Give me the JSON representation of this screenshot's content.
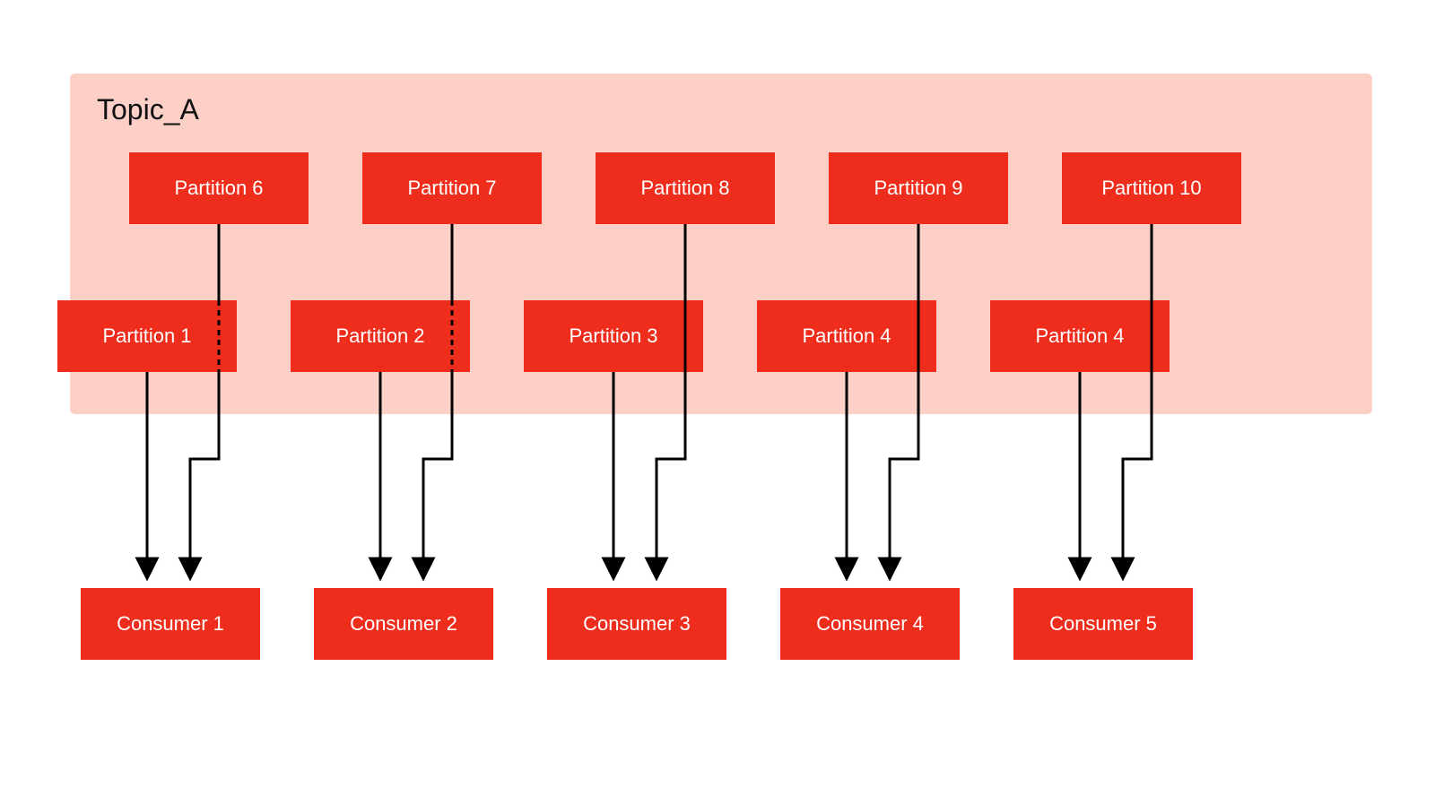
{
  "topic": {
    "title": "Topic_A"
  },
  "colors": {
    "box": "#ee2d1d",
    "containerBg": "#fccfc7",
    "text": "#ffffff",
    "line": "#000000"
  },
  "upperPartitions": [
    {
      "label": "Partition 6"
    },
    {
      "label": "Partition 7"
    },
    {
      "label": "Partition 8"
    },
    {
      "label": "Partition 9"
    },
    {
      "label": "Partition 10"
    }
  ],
  "lowerPartitions": [
    {
      "label": "Partition 1"
    },
    {
      "label": "Partition 2"
    },
    {
      "label": "Partition 3"
    },
    {
      "label": "Partition 4"
    },
    {
      "label": "Partition 4"
    }
  ],
  "consumers": [
    {
      "label": "Consumer 1"
    },
    {
      "label": "Consumer 2"
    },
    {
      "label": "Consumer 3"
    },
    {
      "label": "Consumer 4"
    },
    {
      "label": "Consumer 5"
    }
  ]
}
